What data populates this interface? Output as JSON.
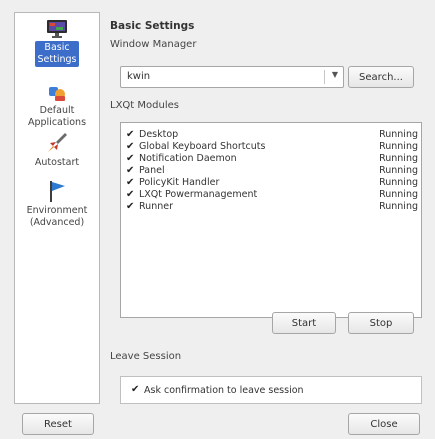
{
  "sidebar": {
    "items": [
      {
        "label": "Basic Settings",
        "line1": "Basic",
        "line2": "Settings",
        "selected": true,
        "icon": "monitor-icon"
      },
      {
        "label": "Default Applications",
        "line1": "Default",
        "line2": "Applications",
        "selected": false,
        "icon": "applications-icon"
      },
      {
        "label": "Autostart",
        "line1": "Autostart",
        "line2": "",
        "selected": false,
        "icon": "rocket-icon"
      },
      {
        "label": "Environment (Advanced)",
        "line1": "Environment",
        "line2": "(Advanced)",
        "selected": false,
        "icon": "flag-icon"
      }
    ]
  },
  "basic": {
    "title": "Basic Settings",
    "window_manager_label": "Window Manager",
    "window_manager_value": "kwin",
    "search_button": "Search...",
    "modules_label": "LXQt Modules",
    "modules": [
      {
        "name": "Desktop",
        "status": "Running",
        "checked": true
      },
      {
        "name": "Global Keyboard Shortcuts",
        "status": "Running",
        "checked": true
      },
      {
        "name": "Notification Daemon",
        "status": "Running",
        "checked": true
      },
      {
        "name": "Panel",
        "status": "Running",
        "checked": true
      },
      {
        "name": "PolicyKit Handler",
        "status": "Running",
        "checked": true
      },
      {
        "name": "LXQt Powermanagement",
        "status": "Running",
        "checked": true
      },
      {
        "name": "Runner",
        "status": "Running",
        "checked": true
      }
    ],
    "start_button": "Start",
    "stop_button": "Stop",
    "leave_session_label": "Leave Session",
    "leave_confirm_text": "Ask confirmation to leave session",
    "leave_confirm_checked": true
  },
  "footer": {
    "reset_button": "Reset",
    "close_button": "Close"
  },
  "colors": {
    "selection": "#3b6dc9",
    "background": "#efefef"
  }
}
